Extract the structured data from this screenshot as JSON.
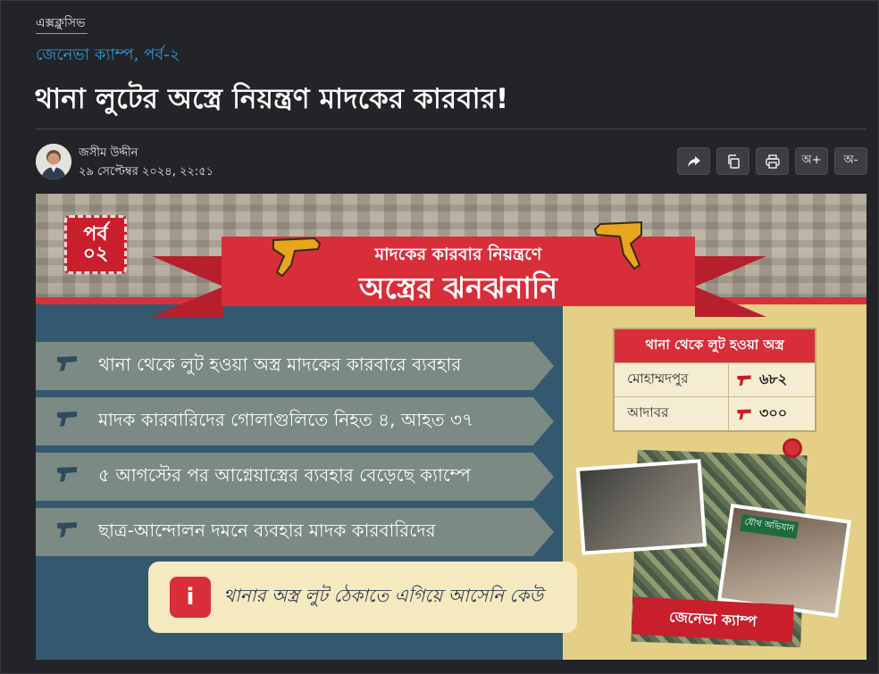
{
  "article": {
    "category": "এক্সক্লুসিভ",
    "series": "জেনেভা ক্যাম্প, পর্ব-২",
    "headline": "থানা লুটের অস্ত্রে নিয়ন্ত্রণ মাদকের কারবার!",
    "author": "জসীম উদ্দীন",
    "published": "২৯ সেপ্টেম্বর ২০২৪, ২২:৫১"
  },
  "toolbar": {
    "share_icon": "share-icon",
    "copy_icon": "copy-icon",
    "print_icon": "print-icon",
    "font_increase": "অ+",
    "font_decrease": "অ-"
  },
  "infographic": {
    "episode_label": "পর্ব",
    "episode_number": "০২",
    "banner_subtitle": "মাদকের কারবার নিয়ন্ত্রণে",
    "banner_title": "অস্ত্রের ঝনঝনানি",
    "points": [
      "থানা থেকে লুট হওয়া অস্ত্র মাদকের কারবারে ব্যবহার",
      "মাদক কারবারিদের গোলাগুলিতে নিহত ৪, আহত ৩৭",
      "৫ আগস্টের পর আগ্নেয়াস্ত্রের ব্যবহার বেড়েছে ক্যাম্পে",
      "ছাত্র-আন্দোলন দমনে ব্যবহার মাদক কারবারিদের"
    ],
    "callout": "থানার অস্ত্র লুট ঠেকাতে এগিয়ে আসেনি কেউ",
    "table": {
      "title": "থানা থেকে লুট হওয়া অস্ত্র",
      "rows": [
        {
          "name": "মোহাম্মদপুর",
          "value": "৬৮২"
        },
        {
          "name": "আদাবর",
          "value": "৩০০"
        }
      ]
    },
    "photo_tag": "যৌথ অভিযান",
    "camp_label": "জেনেভা ক্যাম্প"
  },
  "colors": {
    "background": "#232427",
    "accent_blue": "#2e9bd6",
    "brand_red": "#d82e3a"
  }
}
